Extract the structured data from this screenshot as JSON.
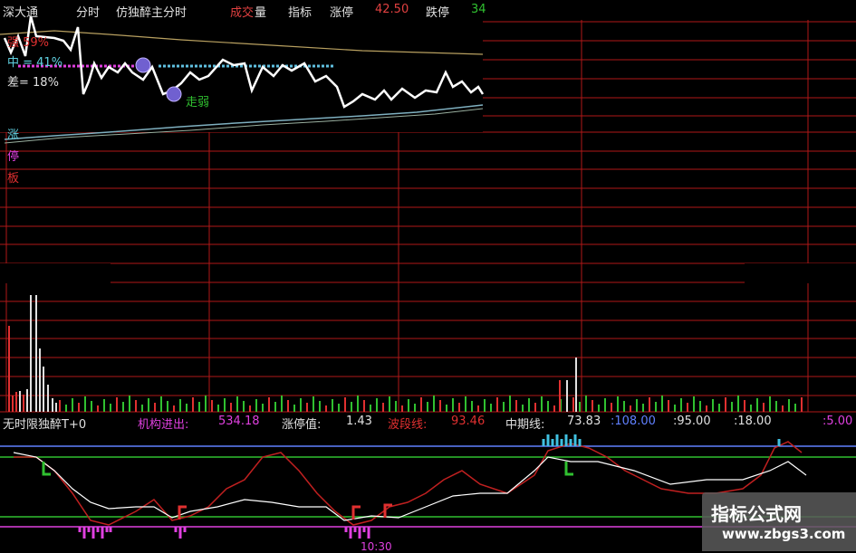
{
  "header": {
    "market": "深大通",
    "mode": "分时",
    "indicator_name": "仿独醉主分时",
    "vol_a": "成交",
    "vol_b": "量",
    "menu_indicator": "指标",
    "limit_up_label": "涨停",
    "limit_up_value": "42.50",
    "limit_down_label": "跌停",
    "limit_down_value": "34"
  },
  "main_panel": {
    "strong": "强 59%",
    "mid": "中 = 41%",
    "weak": "差= 18%",
    "status_tag": "走弱",
    "side_labels": [
      "涨",
      "停",
      "板"
    ]
  },
  "indicator_bar": {
    "name": "无时限独醉T+0",
    "inst_label": "机构进出:",
    "inst_value": "534.18",
    "limit_label": "涨停值:",
    "limit_value": "1.43",
    "band_label": "波段线:",
    "band_value": "93.46",
    "mid_label": "中期线:",
    "mid_value": "73.83",
    "v1": ":108.00",
    "v2": ":95.00",
    "v3": ":18.00",
    "v4": ":5.00"
  },
  "bottom_text": "10:30",
  "watermark": {
    "line1": "指标公式网",
    "line2": "www.zbgs3.com"
  },
  "colors": {
    "grid_red": "#b01818",
    "white_line": "#ffffff",
    "avg_line": "#7fb0c0",
    "magenta": "#e040e0",
    "cyan_bar": "#40c0e0",
    "green_line": "#30c030",
    "blue_line": "#6080ff"
  },
  "icons": [
    "sad-face-icon",
    "sad-face-icon",
    "sad-face-icon"
  ]
}
